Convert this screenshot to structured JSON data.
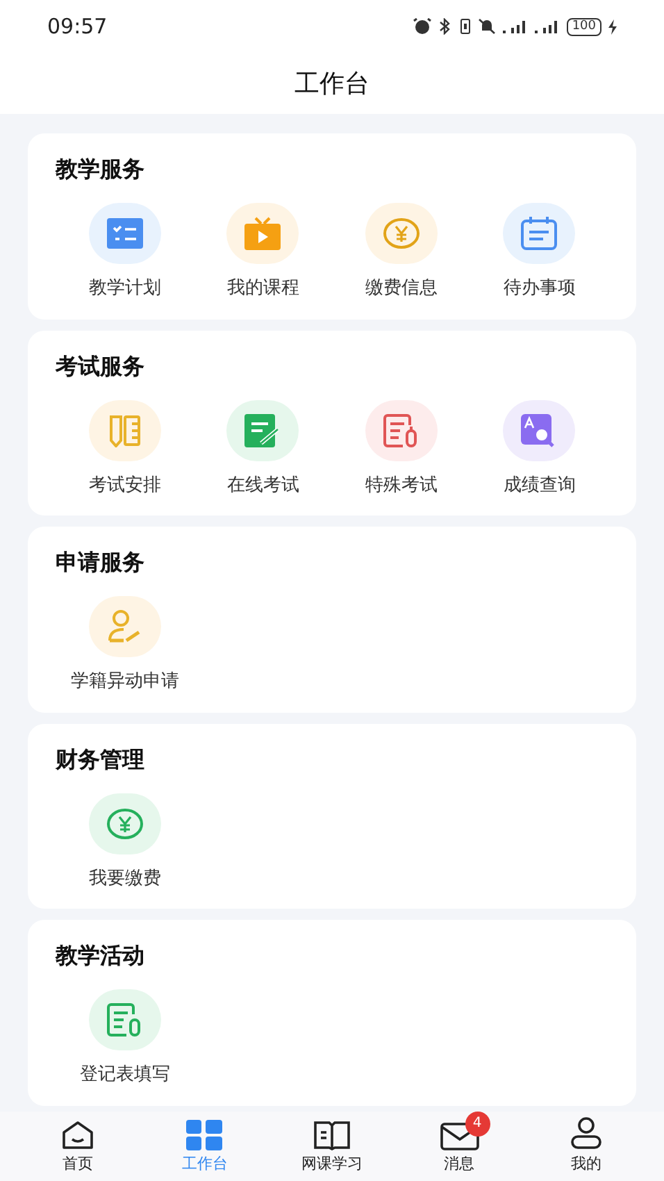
{
  "status_bar": {
    "time": "09:57",
    "battery": "100"
  },
  "header": {
    "title": "工作台"
  },
  "sections": [
    {
      "title": "教学服务",
      "items": [
        {
          "label": "教学计划"
        },
        {
          "label": "我的课程"
        },
        {
          "label": "缴费信息"
        },
        {
          "label": "待办事项"
        }
      ]
    },
    {
      "title": "考试服务",
      "items": [
        {
          "label": "考试安排"
        },
        {
          "label": "在线考试"
        },
        {
          "label": "特殊考试"
        },
        {
          "label": "成绩查询"
        }
      ]
    },
    {
      "title": "申请服务",
      "items": [
        {
          "label": "学籍异动申请"
        }
      ]
    },
    {
      "title": "财务管理",
      "items": [
        {
          "label": "我要缴费"
        }
      ]
    },
    {
      "title": "教学活动",
      "items": [
        {
          "label": "登记表填写"
        }
      ]
    }
  ],
  "tab_bar": [
    {
      "label": "首页",
      "selected": false
    },
    {
      "label": "工作台",
      "selected": true
    },
    {
      "label": "网课学习",
      "selected": false
    },
    {
      "label": "消息",
      "selected": false,
      "badge": "4"
    },
    {
      "label": "我的",
      "selected": false
    }
  ]
}
